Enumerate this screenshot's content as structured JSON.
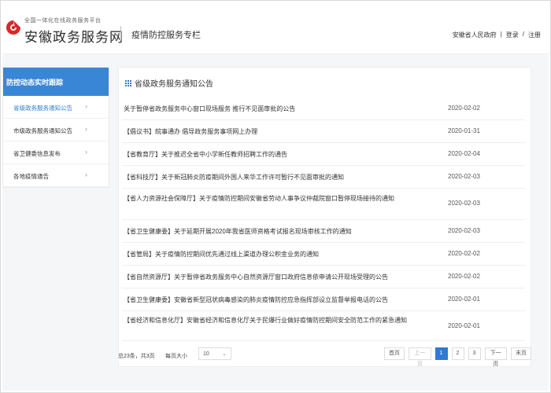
{
  "header": {
    "platform_sub": "全国一体化在线政务服务平台",
    "site_name": "安徽政务服务网",
    "column_title": "疫情防控服务专栏",
    "gov_link": "安徽省人民政府",
    "login": "登录",
    "slash": "/",
    "register": "注册",
    "brand_color": "#d7282a"
  },
  "sidebar": {
    "heading": "防控动态实时跟踪",
    "items": [
      {
        "label": "省级政务服务通知公告"
      },
      {
        "label": "市级政务服务通知公告"
      },
      {
        "label": "省卫健委信息发布"
      },
      {
        "label": "各地疫情通告"
      }
    ],
    "accent_color": "#3a86d6"
  },
  "panel": {
    "title": "省级政务服务通知公告",
    "notices": [
      {
        "title": "关于暂停省政务服务中心窗口现场服务 推行不见面审批的公告",
        "date": "2020-02-02"
      },
      {
        "title": "【倡议书】皖事通办 倡导政务服务事项网上办理",
        "date": "2020-01-31"
      },
      {
        "title": "【省教育厅】关于推迟全省中小学新任教师招聘工作的通告",
        "date": "2020-02-04"
      },
      {
        "title": "【省科技厅】关于新冠肺炎防疫期间外国人来华工作许可暂行不见面审批的通知",
        "date": "2020-02-03"
      },
      {
        "title": "【省人力资源社会保障厅】关于疫情防控期间安徽省劳动人事争议仲裁院窗口暂停现场接待的通知",
        "date": "2020-02-03"
      },
      {
        "title": "【省卫生健康委】关于延期开展2020年我省医师资格考试报名现场审核工作的通知",
        "date": "2020-02-03"
      },
      {
        "title": "【省管局】关于疫情防控期间优先通过线上渠道办理公积金业务的通知",
        "date": "2020-02-02"
      },
      {
        "title": "【省自然资源厅】关于暂停省政务服务中心自然资源厅窗口政府信息依申请公开现场受理的公告",
        "date": "2020-02-02"
      },
      {
        "title": "【省卫生健康委】安徽省新型冠状病毒感染的肺炎疫情防控应急指挥部设立监督举报电话的公告",
        "date": "2020-02-01"
      },
      {
        "title": "【省经济和信息化厅】安徽省经济和信息化厅关于民爆行业做好疫情防控期间安全防范工作的紧急通知",
        "date": "2020-02-01"
      }
    ]
  },
  "footer": {
    "total": "总23条，共3页",
    "page_size_label": "每页大小",
    "page_size": "10",
    "first": "首页",
    "prev": "上一页",
    "pages": [
      "1",
      "2",
      "3"
    ],
    "current_page": "1",
    "next": "下一页",
    "last": "末页",
    "active_color": "#2f7bd3"
  }
}
